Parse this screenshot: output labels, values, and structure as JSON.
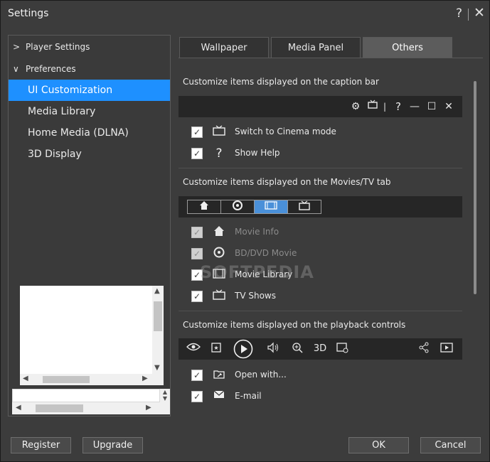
{
  "window": {
    "title": "Settings",
    "help_glyph": "?",
    "close_glyph": "✕"
  },
  "nav": {
    "groups": [
      {
        "label": "Player Settings",
        "chevron": ">"
      },
      {
        "label": "Preferences",
        "chevron": "∨"
      }
    ],
    "items": [
      {
        "label": "UI Customization",
        "active": true
      },
      {
        "label": "Media Library"
      },
      {
        "label": "Home Media (DLNA)"
      },
      {
        "label": "3D Display"
      }
    ]
  },
  "tabs": [
    {
      "label": "Wallpaper"
    },
    {
      "label": "Media Panel"
    },
    {
      "label": "Others",
      "active": true
    }
  ],
  "sections": {
    "caption": {
      "title": "Customize items displayed on the caption bar",
      "items": [
        {
          "label": "Switch to Cinema mode",
          "icon": "tv-icon",
          "checked": true
        },
        {
          "label": "Show Help",
          "icon": "help-icon",
          "checked": true
        }
      ]
    },
    "movies": {
      "title": "Customize items displayed on the Movies/TV tab",
      "items": [
        {
          "label": "Movie Info",
          "icon": "home-icon",
          "checked": true,
          "disabled": true
        },
        {
          "label": "BD/DVD Movie",
          "icon": "disc-icon",
          "checked": true,
          "disabled": true
        },
        {
          "label": "Movie Library",
          "icon": "film-icon",
          "checked": true
        },
        {
          "label": "TV Shows",
          "icon": "tv-icon",
          "checked": true
        }
      ]
    },
    "playback": {
      "title": "Customize items displayed on the playback controls",
      "three_d_label": "3D",
      "items": [
        {
          "label": "Open with...",
          "icon": "open-folder-icon",
          "checked": true
        },
        {
          "label": "E-mail",
          "icon": "mail-icon",
          "checked": true
        }
      ]
    }
  },
  "watermark": "SOFTPEDIA",
  "buttons": {
    "register": "Register",
    "upgrade": "Upgrade",
    "ok": "OK",
    "cancel": "Cancel"
  },
  "colors": {
    "accent": "#1e90ff",
    "background": "#3c3c3c",
    "bar": "#262626"
  }
}
